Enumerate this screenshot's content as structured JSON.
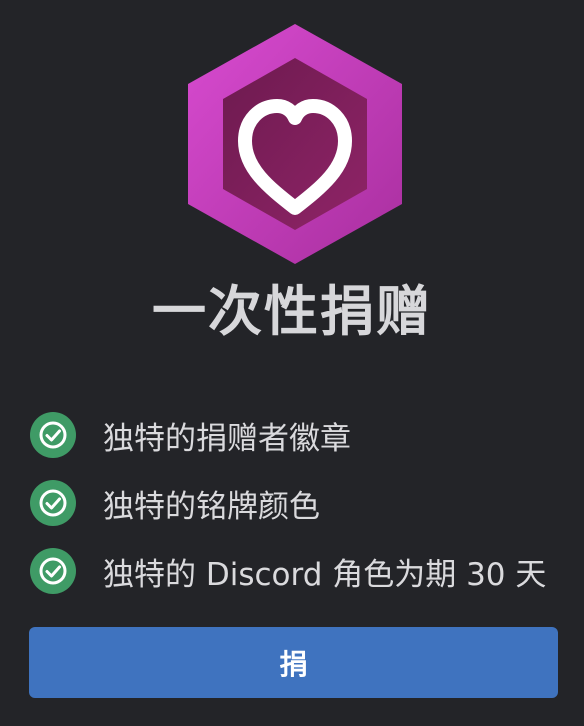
{
  "title": "一次性捐赠",
  "badge_icon": "heart-hexagon-icon",
  "features": [
    {
      "icon": "check-circle-icon",
      "text": "独特的捐赠者徽章"
    },
    {
      "icon": "check-circle-icon",
      "text": "独特的铭牌颜色"
    },
    {
      "icon": "check-circle-icon",
      "text": "独特的 Discord 角色为期 30 天"
    }
  ],
  "donate_button": {
    "label": "捐"
  },
  "colors": {
    "background": "#232428",
    "badge": "#c53fbd",
    "check": "#3f9b66",
    "button": "#3f73bf"
  }
}
